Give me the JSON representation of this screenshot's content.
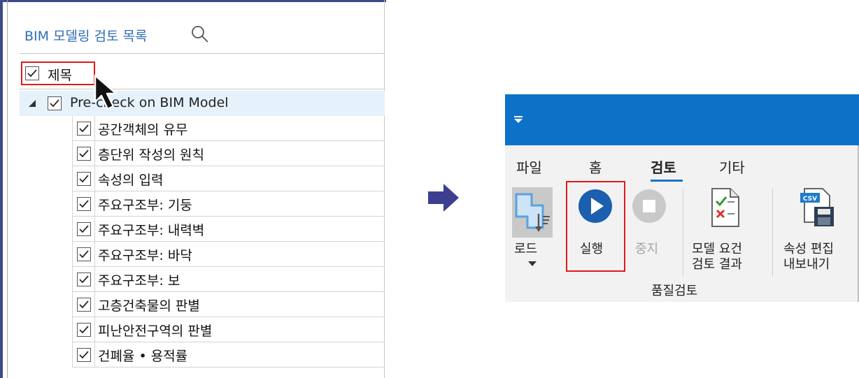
{
  "left_panel": {
    "title": "BIM 모델링 검토 목록",
    "header": {
      "label": "제목",
      "checked": true
    },
    "root": {
      "label": "Pre-check on BIM Model",
      "checked": true,
      "expanded": true
    },
    "items": [
      {
        "label": "공간객체의 유무",
        "checked": true
      },
      {
        "label": "층단위 작성의 원칙",
        "checked": true
      },
      {
        "label": "속성의 입력",
        "checked": true
      },
      {
        "label": "주요구조부: 기둥",
        "checked": true
      },
      {
        "label": "주요구조부: 내력벽",
        "checked": true
      },
      {
        "label": "주요구조부: 바닥",
        "checked": true
      },
      {
        "label": "주요구조부: 보",
        "checked": true
      },
      {
        "label": "고층건축물의 판별",
        "checked": true
      },
      {
        "label": "피난안전구역의 판별",
        "checked": true
      },
      {
        "label": "건폐율 • 용적률",
        "checked": true
      }
    ]
  },
  "ribbon": {
    "tabs": [
      "파일",
      "홈",
      "검토",
      "기타"
    ],
    "active_tab": "검토",
    "commands": {
      "load": "로드",
      "run": "실행",
      "stop": "중지",
      "model_review_line1": "모델 요건",
      "model_review_line2": "검토 결과",
      "attr_edit_line1": "속성 편집",
      "attr_edit_line2": "내보내기"
    },
    "group_label": "품질검토"
  },
  "colors": {
    "ribbon_blue": "#0b72c8",
    "highlight_red": "#e01a1a",
    "title_blue": "#2f6eb3",
    "root_row_bg": "#e5f1fb",
    "arrow_navy": "#3c3f8f"
  }
}
